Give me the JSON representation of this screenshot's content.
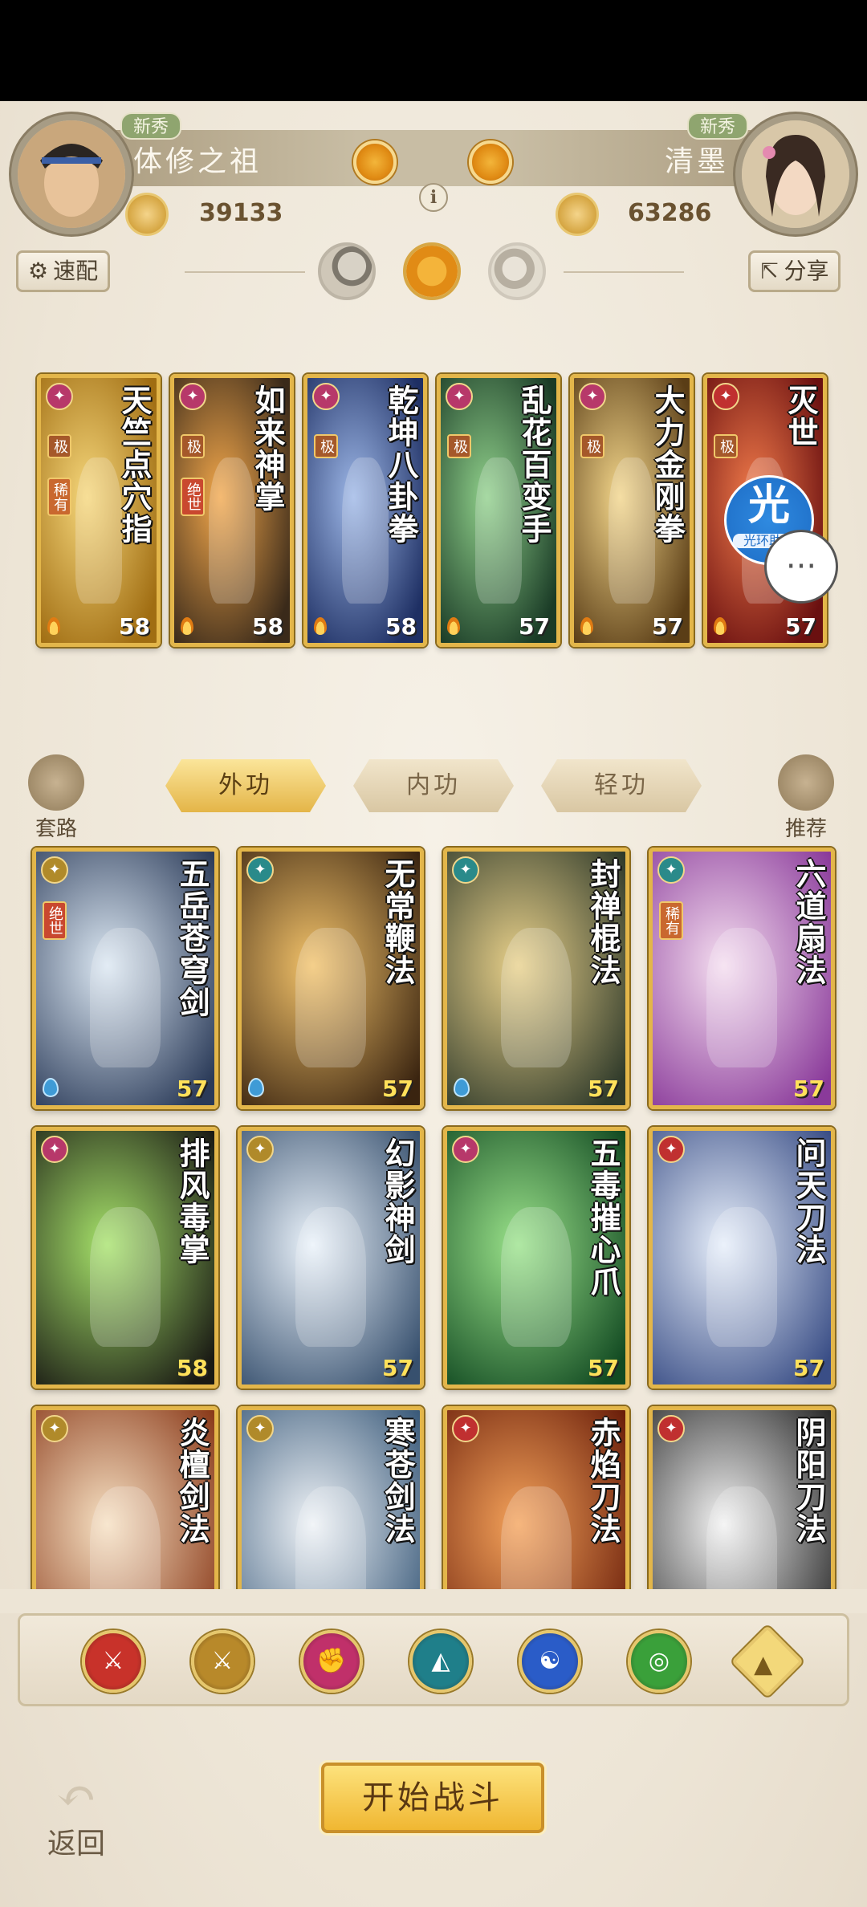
{
  "header": {
    "left_player": {
      "tag": "新秀",
      "name": "体修之祖",
      "score": "39133"
    },
    "right_player": {
      "tag": "新秀",
      "name": "清墨",
      "score": "63286"
    },
    "info_icon": "i",
    "quick_config_label": "速配",
    "share_label": "分享"
  },
  "deck_cards": [
    {
      "title": "天竺点穴指",
      "level": "58",
      "badges": [
        "极",
        "稀有"
      ],
      "colors": [
        "#f5d67a",
        "#a06d12"
      ]
    },
    {
      "title": "如来神掌",
      "level": "58",
      "badges": [
        "极",
        "绝世"
      ],
      "colors": [
        "#f2a74b",
        "#3a2a1a"
      ]
    },
    {
      "title": "乾坤八卦拳",
      "level": "58",
      "badges": [
        "极"
      ],
      "colors": [
        "#9cb6e6",
        "#1e2f63"
      ]
    },
    {
      "title": "乱花百变手",
      "level": "57",
      "badges": [
        "极"
      ],
      "colors": [
        "#8fcf8a",
        "#1a3b26"
      ]
    },
    {
      "title": "大力金刚拳",
      "level": "57",
      "badges": [
        "极"
      ],
      "colors": [
        "#f2d58a",
        "#5a3d16"
      ]
    },
    {
      "title": "灭世",
      "level": "57",
      "badges": [
        "极"
      ],
      "colors": [
        "#f07a4a",
        "#6a1010"
      ]
    }
  ],
  "skill_tabs": {
    "active": "外功",
    "tab2": "内功",
    "tab3": "轻功"
  },
  "side_buttons": {
    "left": "套路",
    "right": "推荐"
  },
  "skill_cards": [
    {
      "title": "五岳苍穹剑",
      "level": "57",
      "badge": "绝世",
      "colors": [
        "#dbe7f2",
        "#2a3a58"
      ]
    },
    {
      "title": "无常鞭法",
      "level": "57",
      "badge": "",
      "colors": [
        "#f2c26a",
        "#3a2410"
      ]
    },
    {
      "title": "封禅棍法",
      "level": "57",
      "badge": "",
      "colors": [
        "#e8d08a",
        "#2f3a2a"
      ]
    },
    {
      "title": "六道扇法",
      "level": "57",
      "badge": "稀有",
      "colors": [
        "#f4ddef",
        "#8a3a9a"
      ]
    },
    {
      "title": "排风毒掌",
      "level": "58",
      "badge": "",
      "colors": [
        "#a6e26a",
        "#1a1a14"
      ]
    },
    {
      "title": "幻影神剑",
      "level": "57",
      "badge": "",
      "colors": [
        "#eaf2fa",
        "#37506e"
      ]
    },
    {
      "title": "五毒摧心爪",
      "level": "57",
      "badge": "",
      "colors": [
        "#9ae28a",
        "#124a22"
      ]
    },
    {
      "title": "问天刀法",
      "level": "57",
      "badge": "",
      "colors": [
        "#e6eefa",
        "#3a4e86"
      ]
    },
    {
      "title": "炎檀剑法",
      "level": "",
      "badge": "",
      "colors": [
        "#f6e0c2",
        "#8a3a1a"
      ]
    },
    {
      "title": "寒苍剑法",
      "level": "",
      "badge": "",
      "colors": [
        "#eef2f6",
        "#3a5a7a"
      ]
    },
    {
      "title": "赤焰刀法",
      "level": "",
      "badge": "",
      "colors": [
        "#f4a25a",
        "#6a1e0a"
      ]
    },
    {
      "title": "阴阳刀法",
      "level": "",
      "badge": "",
      "colors": [
        "#f2f2f2",
        "#2a2a2a"
      ]
    }
  ],
  "filter_icons": [
    {
      "name": "sword-red-icon",
      "color": "#c8322a"
    },
    {
      "name": "sword-gold-icon",
      "color": "#b8892a"
    },
    {
      "name": "fist-pink-icon",
      "color": "#c0306a"
    },
    {
      "name": "fan-teal-icon",
      "color": "#1f7f8a"
    },
    {
      "name": "yinyang-blue-icon",
      "color": "#2a5cc8"
    },
    {
      "name": "whip-green-icon",
      "color": "#3aa03a"
    },
    {
      "name": "collapse-up-icon",
      "color": "#f3d87a"
    }
  ],
  "start_button": "开始战斗",
  "back_button": "返回",
  "helper": {
    "icon": "光",
    "label": "光环助手"
  }
}
